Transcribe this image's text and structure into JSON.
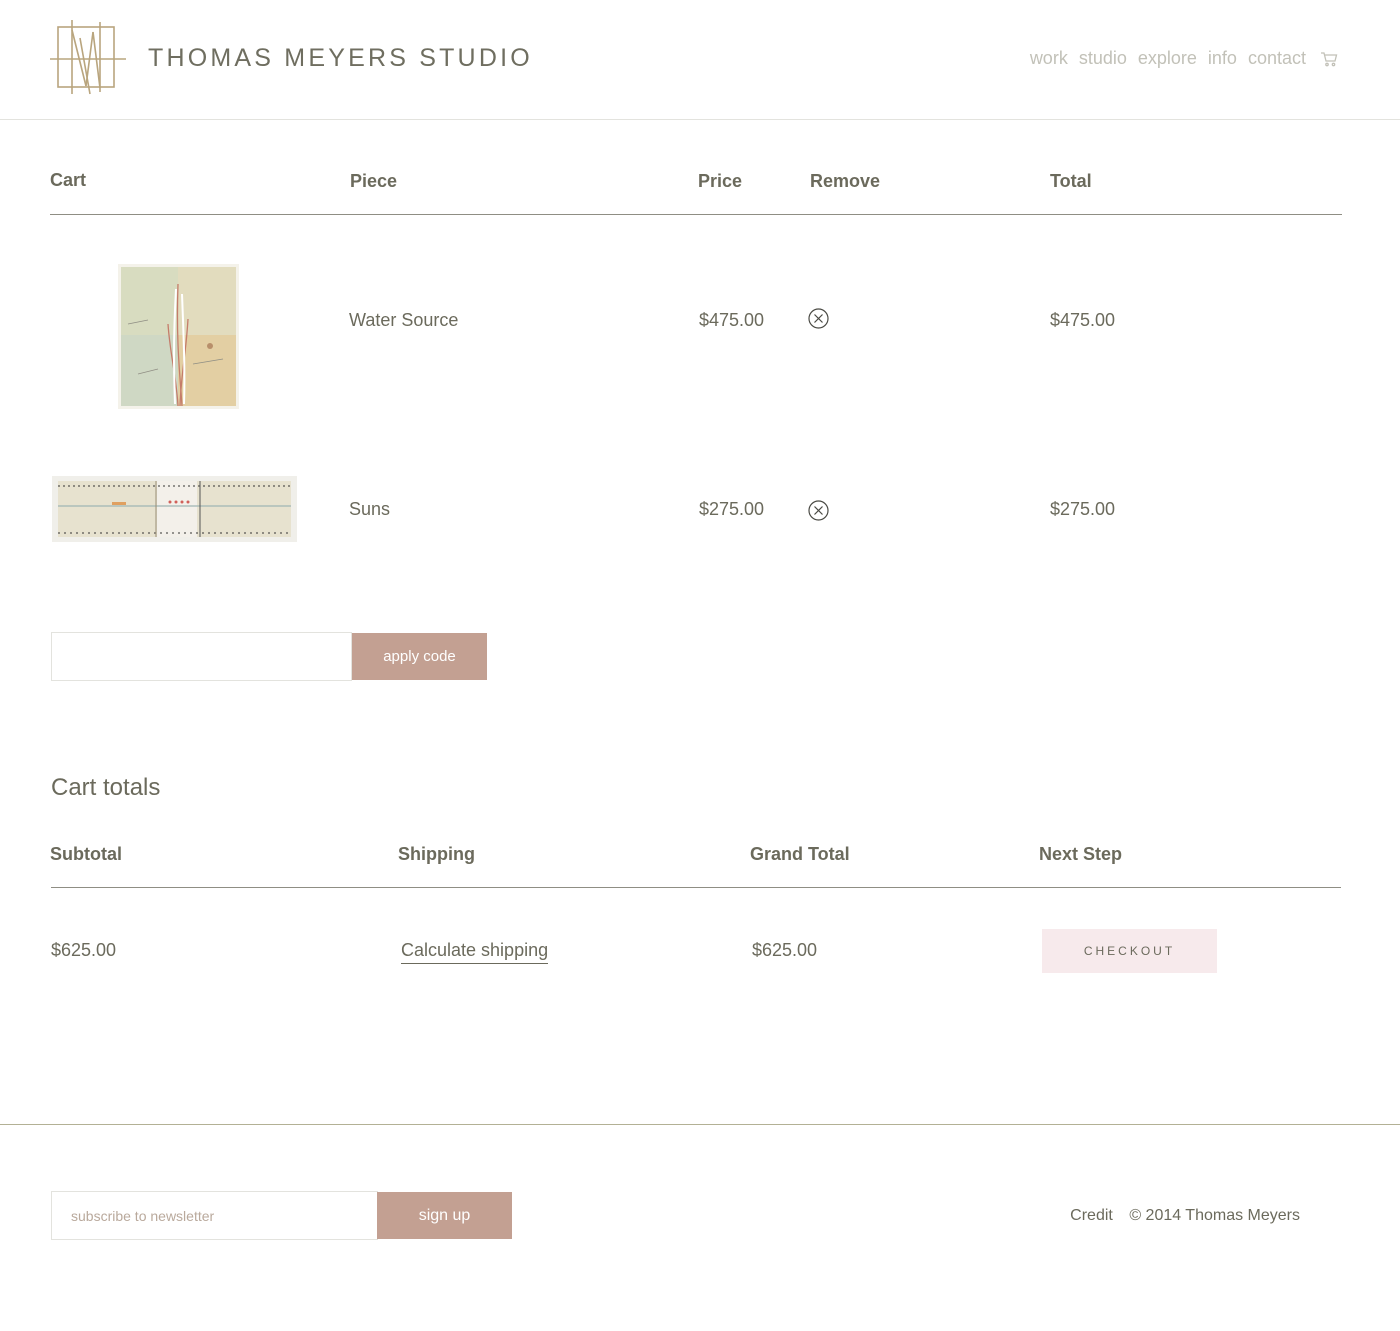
{
  "brand": {
    "name": "THOMAS MEYERS STUDIO"
  },
  "nav": {
    "items": [
      "work",
      "studio",
      "explore",
      "info",
      "contact"
    ],
    "cart_icon": "cart-icon"
  },
  "cart": {
    "headers": {
      "cart": "Cart",
      "piece": "Piece",
      "price": "Price",
      "remove": "Remove",
      "total": "Total"
    },
    "items": [
      {
        "piece": "Water Source",
        "price": "$475.00",
        "total": "$475.00",
        "remove_icon": "remove-circle-icon"
      },
      {
        "piece": "Suns",
        "price": "$275.00",
        "total": "$275.00",
        "remove_icon": "remove-circle-icon"
      }
    ],
    "coupon": {
      "placeholder": "",
      "button_label": "apply code"
    }
  },
  "totals": {
    "title": "Cart totals",
    "headers": {
      "subtotal": "Subtotal",
      "shipping": "Shipping",
      "grand_total": "Grand Total",
      "next_step": "Next Step"
    },
    "subtotal": "$625.00",
    "shipping_link": "Calculate shipping",
    "grand_total": "$625.00",
    "checkout_label": "CHECKOUT"
  },
  "footer": {
    "newsletter_placeholder": "subscribe to newsletter",
    "signup_label": "sign up",
    "credit": "Credit",
    "copyright": "© 2014 Thomas Meyers"
  },
  "colors": {
    "accent": "#c3a092",
    "checkout_bg": "#f7eaec",
    "text": "#6b6a5c",
    "nav_text": "#c2c1b8",
    "logo": "#b9a57e"
  }
}
